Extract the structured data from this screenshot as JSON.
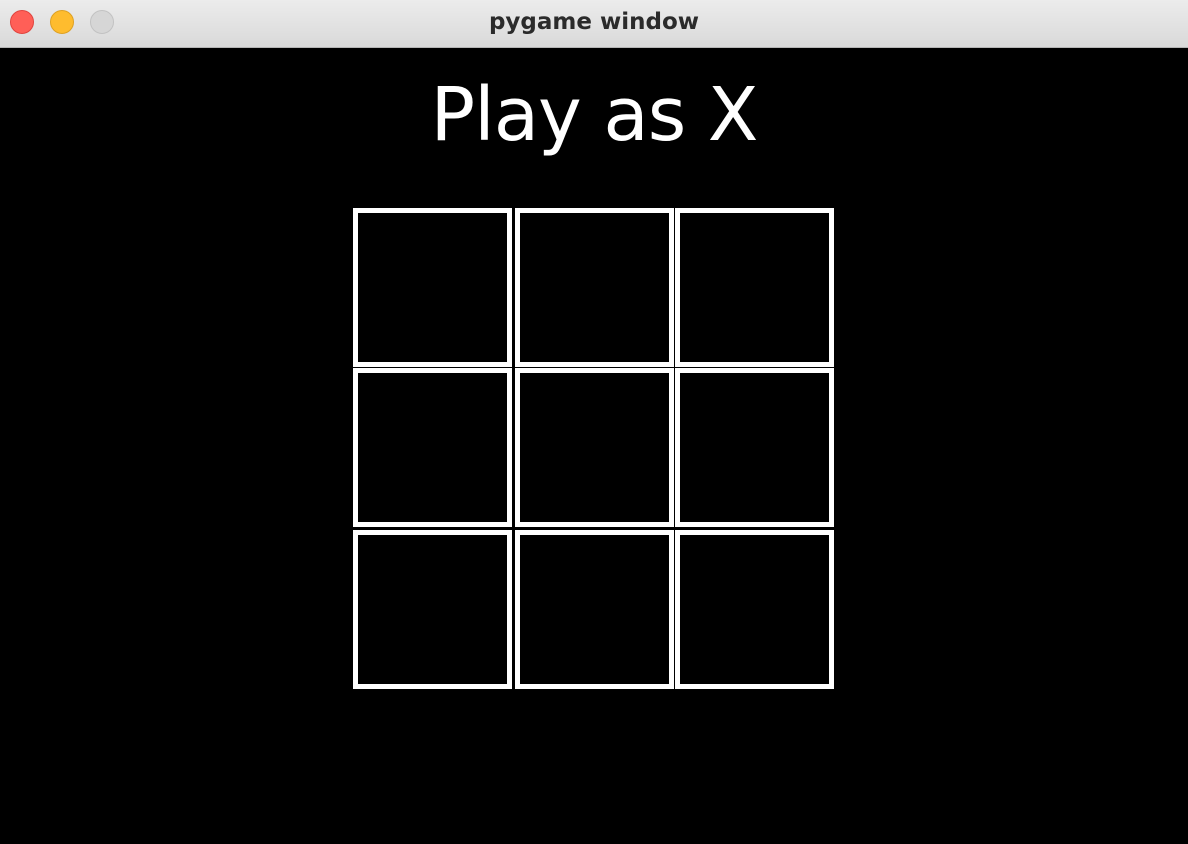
{
  "window": {
    "title": "pygame window"
  },
  "game": {
    "status": "Play as X",
    "board": [
      [
        "",
        "",
        ""
      ],
      [
        "",
        "",
        ""
      ],
      [
        "",
        "",
        ""
      ]
    ]
  },
  "colors": {
    "background": "#000000",
    "grid": "#ffffff",
    "text": "#ffffff"
  }
}
